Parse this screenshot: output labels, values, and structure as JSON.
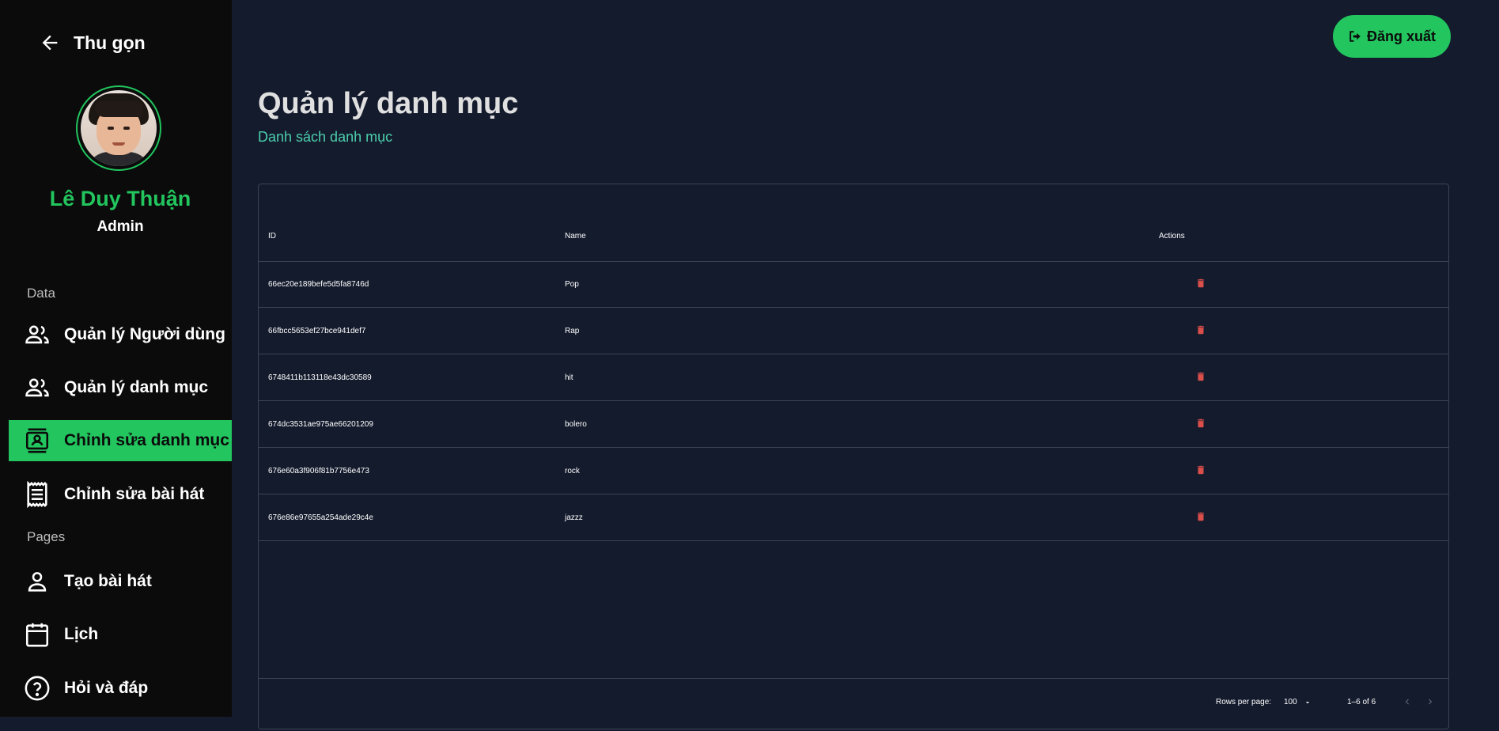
{
  "sidebar": {
    "collapse_label": "Thu gọn",
    "user": {
      "name": "Lê Duy Thuận",
      "role": "Admin"
    },
    "sections": [
      {
        "label": "Data"
      },
      {
        "label": "Pages"
      }
    ],
    "items": [
      {
        "label": "Quản lý Người dùng",
        "icon": "people-icon"
      },
      {
        "label": "Quản lý danh mục",
        "icon": "people-icon"
      },
      {
        "label": "Chỉnh sửa danh mục",
        "icon": "contacts-icon",
        "active": true
      },
      {
        "label": "Chỉnh sửa bài hát",
        "icon": "receipt-icon"
      },
      {
        "label": "Tạo bài hát",
        "icon": "person-icon"
      },
      {
        "label": "Lịch",
        "icon": "calendar-icon"
      },
      {
        "label": "Hỏi và đáp",
        "icon": "help-icon"
      }
    ]
  },
  "header": {
    "logout_label": "Đăng xuất"
  },
  "main": {
    "title": "Quản lý danh mục",
    "subtitle": "Danh sách danh mục"
  },
  "table": {
    "columns": [
      "ID",
      "Name",
      "Actions"
    ],
    "rows": [
      {
        "id": "66ec20e189befe5d5fa8746d",
        "name": "Pop"
      },
      {
        "id": "66fbcc5653ef27bce941def7",
        "name": "Rap"
      },
      {
        "id": "6748411b113118e43dc30589",
        "name": "hit"
      },
      {
        "id": "674dc3531ae975ae66201209",
        "name": "bolero"
      },
      {
        "id": "676e60a3f906f81b7756e473",
        "name": "rock"
      },
      {
        "id": "676e86e97655a254ade29c4e",
        "name": "jazzz"
      }
    ],
    "footer": {
      "rows_per_page_label": "Rows per page:",
      "rows_per_page_value": "100",
      "range": "1–6 of 6"
    }
  },
  "colors": {
    "accent": "#22c55e",
    "background": "#141b2d",
    "sidebar": "#0b0b0b",
    "subtitle": "#4cceac",
    "delete": "#db4f4a"
  }
}
